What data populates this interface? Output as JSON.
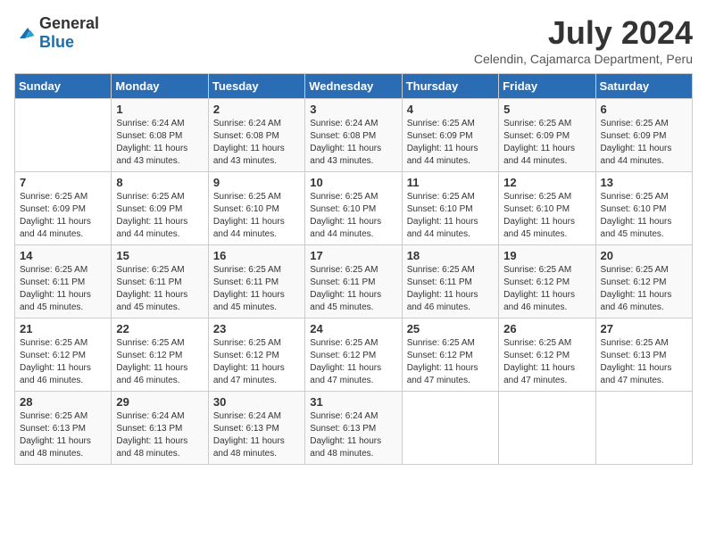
{
  "logo": {
    "text_general": "General",
    "text_blue": "Blue"
  },
  "title": {
    "month": "July 2024",
    "location": "Celendin, Cajamarca Department, Peru"
  },
  "headers": [
    "Sunday",
    "Monday",
    "Tuesday",
    "Wednesday",
    "Thursday",
    "Friday",
    "Saturday"
  ],
  "weeks": [
    [
      {
        "day": "",
        "detail": ""
      },
      {
        "day": "1",
        "detail": "Sunrise: 6:24 AM\nSunset: 6:08 PM\nDaylight: 11 hours\nand 43 minutes."
      },
      {
        "day": "2",
        "detail": "Sunrise: 6:24 AM\nSunset: 6:08 PM\nDaylight: 11 hours\nand 43 minutes."
      },
      {
        "day": "3",
        "detail": "Sunrise: 6:24 AM\nSunset: 6:08 PM\nDaylight: 11 hours\nand 43 minutes."
      },
      {
        "day": "4",
        "detail": "Sunrise: 6:25 AM\nSunset: 6:09 PM\nDaylight: 11 hours\nand 44 minutes."
      },
      {
        "day": "5",
        "detail": "Sunrise: 6:25 AM\nSunset: 6:09 PM\nDaylight: 11 hours\nand 44 minutes."
      },
      {
        "day": "6",
        "detail": "Sunrise: 6:25 AM\nSunset: 6:09 PM\nDaylight: 11 hours\nand 44 minutes."
      }
    ],
    [
      {
        "day": "7",
        "detail": "Sunrise: 6:25 AM\nSunset: 6:09 PM\nDaylight: 11 hours\nand 44 minutes."
      },
      {
        "day": "8",
        "detail": "Sunrise: 6:25 AM\nSunset: 6:09 PM\nDaylight: 11 hours\nand 44 minutes."
      },
      {
        "day": "9",
        "detail": "Sunrise: 6:25 AM\nSunset: 6:10 PM\nDaylight: 11 hours\nand 44 minutes."
      },
      {
        "day": "10",
        "detail": "Sunrise: 6:25 AM\nSunset: 6:10 PM\nDaylight: 11 hours\nand 44 minutes."
      },
      {
        "day": "11",
        "detail": "Sunrise: 6:25 AM\nSunset: 6:10 PM\nDaylight: 11 hours\nand 44 minutes."
      },
      {
        "day": "12",
        "detail": "Sunrise: 6:25 AM\nSunset: 6:10 PM\nDaylight: 11 hours\nand 45 minutes."
      },
      {
        "day": "13",
        "detail": "Sunrise: 6:25 AM\nSunset: 6:10 PM\nDaylight: 11 hours\nand 45 minutes."
      }
    ],
    [
      {
        "day": "14",
        "detail": "Sunrise: 6:25 AM\nSunset: 6:11 PM\nDaylight: 11 hours\nand 45 minutes."
      },
      {
        "day": "15",
        "detail": "Sunrise: 6:25 AM\nSunset: 6:11 PM\nDaylight: 11 hours\nand 45 minutes."
      },
      {
        "day": "16",
        "detail": "Sunrise: 6:25 AM\nSunset: 6:11 PM\nDaylight: 11 hours\nand 45 minutes."
      },
      {
        "day": "17",
        "detail": "Sunrise: 6:25 AM\nSunset: 6:11 PM\nDaylight: 11 hours\nand 45 minutes."
      },
      {
        "day": "18",
        "detail": "Sunrise: 6:25 AM\nSunset: 6:11 PM\nDaylight: 11 hours\nand 46 minutes."
      },
      {
        "day": "19",
        "detail": "Sunrise: 6:25 AM\nSunset: 6:12 PM\nDaylight: 11 hours\nand 46 minutes."
      },
      {
        "day": "20",
        "detail": "Sunrise: 6:25 AM\nSunset: 6:12 PM\nDaylight: 11 hours\nand 46 minutes."
      }
    ],
    [
      {
        "day": "21",
        "detail": "Sunrise: 6:25 AM\nSunset: 6:12 PM\nDaylight: 11 hours\nand 46 minutes."
      },
      {
        "day": "22",
        "detail": "Sunrise: 6:25 AM\nSunset: 6:12 PM\nDaylight: 11 hours\nand 46 minutes."
      },
      {
        "day": "23",
        "detail": "Sunrise: 6:25 AM\nSunset: 6:12 PM\nDaylight: 11 hours\nand 47 minutes."
      },
      {
        "day": "24",
        "detail": "Sunrise: 6:25 AM\nSunset: 6:12 PM\nDaylight: 11 hours\nand 47 minutes."
      },
      {
        "day": "25",
        "detail": "Sunrise: 6:25 AM\nSunset: 6:12 PM\nDaylight: 11 hours\nand 47 minutes."
      },
      {
        "day": "26",
        "detail": "Sunrise: 6:25 AM\nSunset: 6:12 PM\nDaylight: 11 hours\nand 47 minutes."
      },
      {
        "day": "27",
        "detail": "Sunrise: 6:25 AM\nSunset: 6:13 PM\nDaylight: 11 hours\nand 47 minutes."
      }
    ],
    [
      {
        "day": "28",
        "detail": "Sunrise: 6:25 AM\nSunset: 6:13 PM\nDaylight: 11 hours\nand 48 minutes."
      },
      {
        "day": "29",
        "detail": "Sunrise: 6:24 AM\nSunset: 6:13 PM\nDaylight: 11 hours\nand 48 minutes."
      },
      {
        "day": "30",
        "detail": "Sunrise: 6:24 AM\nSunset: 6:13 PM\nDaylight: 11 hours\nand 48 minutes."
      },
      {
        "day": "31",
        "detail": "Sunrise: 6:24 AM\nSunset: 6:13 PM\nDaylight: 11 hours\nand 48 minutes."
      },
      {
        "day": "",
        "detail": ""
      },
      {
        "day": "",
        "detail": ""
      },
      {
        "day": "",
        "detail": ""
      }
    ]
  ]
}
